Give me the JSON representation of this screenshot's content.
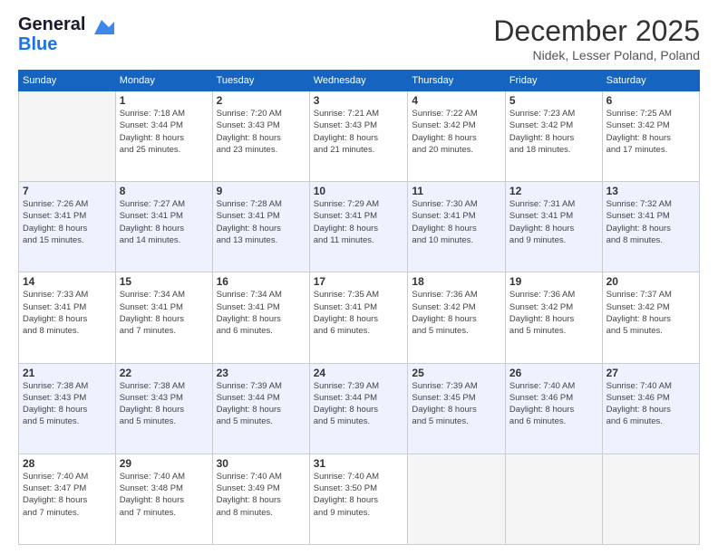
{
  "logo": {
    "line1": "General",
    "line2": "Blue"
  },
  "title": "December 2025",
  "location": "Nidek, Lesser Poland, Poland",
  "days_header": [
    "Sunday",
    "Monday",
    "Tuesday",
    "Wednesday",
    "Thursday",
    "Friday",
    "Saturday"
  ],
  "weeks": [
    [
      {
        "day": "",
        "info": ""
      },
      {
        "day": "1",
        "info": "Sunrise: 7:18 AM\nSunset: 3:44 PM\nDaylight: 8 hours\nand 25 minutes."
      },
      {
        "day": "2",
        "info": "Sunrise: 7:20 AM\nSunset: 3:43 PM\nDaylight: 8 hours\nand 23 minutes."
      },
      {
        "day": "3",
        "info": "Sunrise: 7:21 AM\nSunset: 3:43 PM\nDaylight: 8 hours\nand 21 minutes."
      },
      {
        "day": "4",
        "info": "Sunrise: 7:22 AM\nSunset: 3:42 PM\nDaylight: 8 hours\nand 20 minutes."
      },
      {
        "day": "5",
        "info": "Sunrise: 7:23 AM\nSunset: 3:42 PM\nDaylight: 8 hours\nand 18 minutes."
      },
      {
        "day": "6",
        "info": "Sunrise: 7:25 AM\nSunset: 3:42 PM\nDaylight: 8 hours\nand 17 minutes."
      }
    ],
    [
      {
        "day": "7",
        "info": "Sunrise: 7:26 AM\nSunset: 3:41 PM\nDaylight: 8 hours\nand 15 minutes."
      },
      {
        "day": "8",
        "info": "Sunrise: 7:27 AM\nSunset: 3:41 PM\nDaylight: 8 hours\nand 14 minutes."
      },
      {
        "day": "9",
        "info": "Sunrise: 7:28 AM\nSunset: 3:41 PM\nDaylight: 8 hours\nand 13 minutes."
      },
      {
        "day": "10",
        "info": "Sunrise: 7:29 AM\nSunset: 3:41 PM\nDaylight: 8 hours\nand 11 minutes."
      },
      {
        "day": "11",
        "info": "Sunrise: 7:30 AM\nSunset: 3:41 PM\nDaylight: 8 hours\nand 10 minutes."
      },
      {
        "day": "12",
        "info": "Sunrise: 7:31 AM\nSunset: 3:41 PM\nDaylight: 8 hours\nand 9 minutes."
      },
      {
        "day": "13",
        "info": "Sunrise: 7:32 AM\nSunset: 3:41 PM\nDaylight: 8 hours\nand 8 minutes."
      }
    ],
    [
      {
        "day": "14",
        "info": "Sunrise: 7:33 AM\nSunset: 3:41 PM\nDaylight: 8 hours\nand 8 minutes."
      },
      {
        "day": "15",
        "info": "Sunrise: 7:34 AM\nSunset: 3:41 PM\nDaylight: 8 hours\nand 7 minutes."
      },
      {
        "day": "16",
        "info": "Sunrise: 7:34 AM\nSunset: 3:41 PM\nDaylight: 8 hours\nand 6 minutes."
      },
      {
        "day": "17",
        "info": "Sunrise: 7:35 AM\nSunset: 3:41 PM\nDaylight: 8 hours\nand 6 minutes."
      },
      {
        "day": "18",
        "info": "Sunrise: 7:36 AM\nSunset: 3:42 PM\nDaylight: 8 hours\nand 5 minutes."
      },
      {
        "day": "19",
        "info": "Sunrise: 7:36 AM\nSunset: 3:42 PM\nDaylight: 8 hours\nand 5 minutes."
      },
      {
        "day": "20",
        "info": "Sunrise: 7:37 AM\nSunset: 3:42 PM\nDaylight: 8 hours\nand 5 minutes."
      }
    ],
    [
      {
        "day": "21",
        "info": "Sunrise: 7:38 AM\nSunset: 3:43 PM\nDaylight: 8 hours\nand 5 minutes."
      },
      {
        "day": "22",
        "info": "Sunrise: 7:38 AM\nSunset: 3:43 PM\nDaylight: 8 hours\nand 5 minutes."
      },
      {
        "day": "23",
        "info": "Sunrise: 7:39 AM\nSunset: 3:44 PM\nDaylight: 8 hours\nand 5 minutes."
      },
      {
        "day": "24",
        "info": "Sunrise: 7:39 AM\nSunset: 3:44 PM\nDaylight: 8 hours\nand 5 minutes."
      },
      {
        "day": "25",
        "info": "Sunrise: 7:39 AM\nSunset: 3:45 PM\nDaylight: 8 hours\nand 5 minutes."
      },
      {
        "day": "26",
        "info": "Sunrise: 7:40 AM\nSunset: 3:46 PM\nDaylight: 8 hours\nand 6 minutes."
      },
      {
        "day": "27",
        "info": "Sunrise: 7:40 AM\nSunset: 3:46 PM\nDaylight: 8 hours\nand 6 minutes."
      }
    ],
    [
      {
        "day": "28",
        "info": "Sunrise: 7:40 AM\nSunset: 3:47 PM\nDaylight: 8 hours\nand 7 minutes."
      },
      {
        "day": "29",
        "info": "Sunrise: 7:40 AM\nSunset: 3:48 PM\nDaylight: 8 hours\nand 7 minutes."
      },
      {
        "day": "30",
        "info": "Sunrise: 7:40 AM\nSunset: 3:49 PM\nDaylight: 8 hours\nand 8 minutes."
      },
      {
        "day": "31",
        "info": "Sunrise: 7:40 AM\nSunset: 3:50 PM\nDaylight: 8 hours\nand 9 minutes."
      },
      {
        "day": "",
        "info": ""
      },
      {
        "day": "",
        "info": ""
      },
      {
        "day": "",
        "info": ""
      }
    ]
  ]
}
